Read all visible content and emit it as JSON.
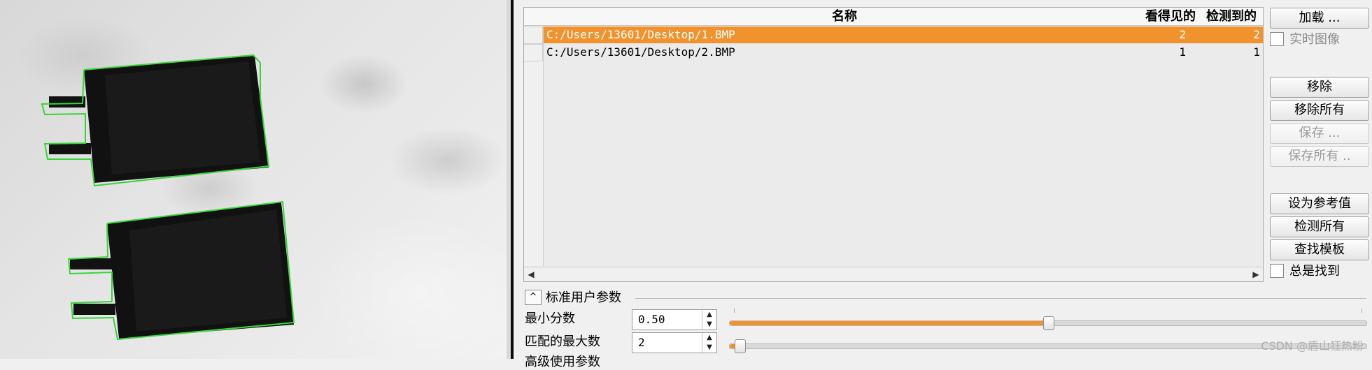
{
  "table": {
    "columns": {
      "name": "名称",
      "visible": "看得见的",
      "detected": "检测到的"
    },
    "rows": [
      {
        "name": "C:/Users/13601/Desktop/1.BMP",
        "visible": "2",
        "detected": "2",
        "selected": true
      },
      {
        "name": "C:/Users/13601/Desktop/2.BMP",
        "visible": "1",
        "detected": "1",
        "selected": false
      }
    ]
  },
  "buttons": {
    "load": "加载 ...",
    "live_image": "实时图像",
    "remove": "移除",
    "remove_all": "移除所有",
    "save": "保存 ...",
    "save_all": "保存所有 ..",
    "set_reference": "设为参考值",
    "detect_all": "检测所有",
    "find_model": "查找模板",
    "always_find": "总是找到"
  },
  "params": {
    "section_title": "标准用户参数",
    "min_score": {
      "label": "最小分数",
      "value": "0.50",
      "slider_fraction": 0.5
    },
    "max_matches": {
      "label": "匹配的最大数",
      "value": "2",
      "slider_fraction": 0.0
    },
    "next_section_cut": "高级使用参数"
  },
  "watermark": "CSDN @盾山狂热粉",
  "colors": {
    "selection": "#f0932f",
    "contour": "#39d43a",
    "battery": "#121212"
  }
}
